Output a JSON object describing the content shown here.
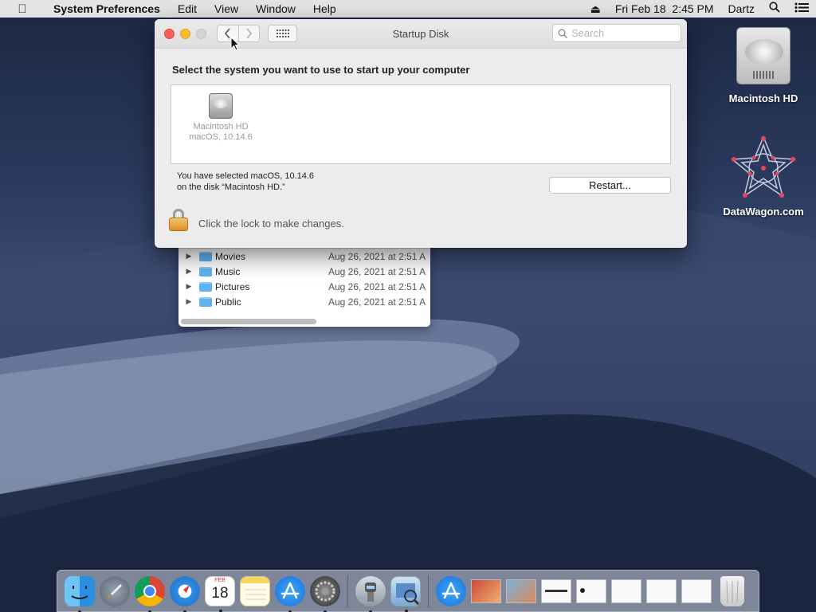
{
  "menubar": {
    "apple_icon": "apple-logo-icon",
    "app_name": "System Preferences",
    "menus": [
      "Edit",
      "View",
      "Window",
      "Help"
    ],
    "eject_icon": "eject-icon",
    "datetime": "Fri Feb 18  2:45 PM",
    "user": "Dartz",
    "search_icon": "spotlight-search-icon",
    "list_icon": "notification-center-icon"
  },
  "desktop": {
    "icons": [
      {
        "label": "Macintosh HD",
        "icon": "hard-drive-icon"
      },
      {
        "label": "DataWagon.com",
        "icon": "datawagon-logo-icon"
      }
    ]
  },
  "finder_background": {
    "rows": [
      {
        "name": "Movies",
        "date": "Aug 26, 2021 at 2:51 A"
      },
      {
        "name": "Music",
        "date": "Aug 26, 2021 at 2:51 A"
      },
      {
        "name": "Pictures",
        "date": "Aug 26, 2021 at 2:51 A"
      },
      {
        "name": "Public",
        "date": "Aug 26, 2021 at 2:51 A"
      }
    ]
  },
  "window": {
    "title": "Startup Disk",
    "search_placeholder": "Search",
    "prompt": "Select the system you want to use to start up your computer",
    "disk": {
      "name": "Macintosh HD",
      "os": "macOS, 10.14.6"
    },
    "selected_line1": "You have selected macOS, 10.14.6",
    "selected_line2": "on the disk “Macintosh HD.”",
    "restart_label": "Restart...",
    "lock_text": "Click the lock to make changes."
  },
  "dock": {
    "apps": [
      "finder",
      "launchpad",
      "chrome",
      "safari",
      "calendar",
      "notes",
      "app-store",
      "system-preferences",
      "automator",
      "preview"
    ],
    "calendar_day": "18",
    "calendar_month": "FEB"
  },
  "colors": {
    "close": "#fc5f57",
    "minimize": "#fdbc2e",
    "zoom_disabled": "#d5d5d5",
    "folder": "#5fb3f0"
  }
}
